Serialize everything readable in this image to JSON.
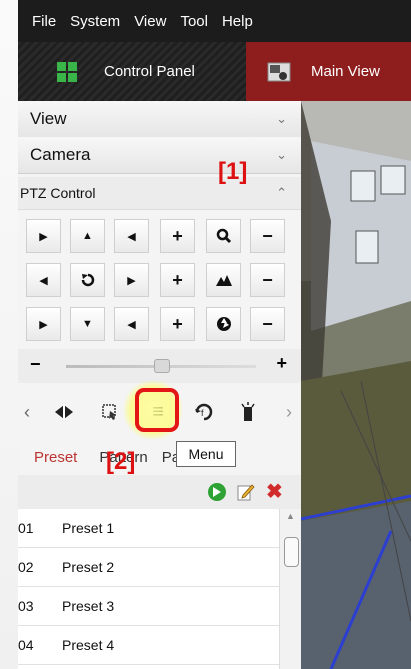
{
  "menubar": {
    "items": [
      "File",
      "System",
      "View",
      "Tool",
      "Help"
    ]
  },
  "tabs": {
    "control_panel": "Control Panel",
    "main_view": "Main View"
  },
  "panel": {
    "view_label": "View",
    "camera_label": "Camera",
    "ptz_label": "PTZ Control"
  },
  "ptz_buttons": {
    "row1": [
      "▶",
      "▲",
      "◀",
      "+",
      "search",
      "−"
    ],
    "row2": [
      "◀",
      "rotate",
      "▶",
      "+",
      "mountains",
      "−"
    ],
    "row3": [
      "▶",
      "▼",
      "◀",
      "+",
      "iris",
      "−"
    ]
  },
  "slider": {
    "minus": "−",
    "plus": "+",
    "value_percent": 50
  },
  "toolbar": {
    "prev": "‹",
    "next": "›",
    "tools": [
      "wiper-icon",
      "region-icon",
      "menu-icon",
      "patrol-icon",
      "light-icon"
    ]
  },
  "preset_tabs": {
    "preset": "Preset",
    "pattern": "Pattern",
    "patrol": "Patrol"
  },
  "presets": [
    {
      "num": "01",
      "name": "Preset 1"
    },
    {
      "num": "02",
      "name": "Preset 2"
    },
    {
      "num": "03",
      "name": "Preset 3"
    },
    {
      "num": "04",
      "name": "Preset 4"
    }
  ],
  "annotations": {
    "label_1": "[1]",
    "label_2": "[2]",
    "tooltip": "Menu"
  },
  "colors": {
    "accent_red": "#e41515",
    "main_tab_bg": "#8e1d1d",
    "menubar_bg": "#1c1c1c",
    "play_green": "#2fa236",
    "delete_red": "#d22b2b"
  }
}
